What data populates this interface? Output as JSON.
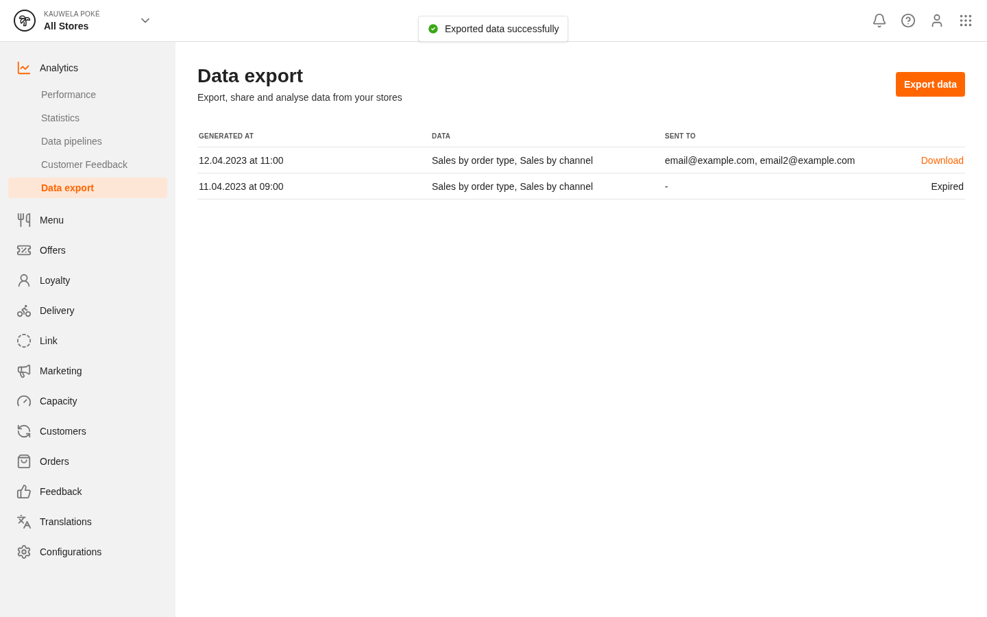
{
  "header": {
    "brand": "KAUWELA POKÉ",
    "store": "All Stores"
  },
  "toast": {
    "message": "Exported data successfully"
  },
  "sidebar": {
    "items": [
      {
        "label": "Analytics",
        "selected": true,
        "expanded": true,
        "children": [
          {
            "label": "Performance",
            "selected": false
          },
          {
            "label": "Statistics",
            "selected": false
          },
          {
            "label": "Data pipelines",
            "selected": false
          },
          {
            "label": "Customer Feedback",
            "selected": false
          },
          {
            "label": "Data export",
            "selected": true
          }
        ]
      },
      {
        "label": "Menu",
        "selected": false
      },
      {
        "label": "Offers",
        "selected": false
      },
      {
        "label": "Loyalty",
        "selected": false
      },
      {
        "label": "Delivery",
        "selected": false
      },
      {
        "label": "Link",
        "selected": false
      },
      {
        "label": "Marketing",
        "selected": false
      },
      {
        "label": "Capacity",
        "selected": false
      },
      {
        "label": "Customers",
        "selected": false
      },
      {
        "label": "Orders",
        "selected": false
      },
      {
        "label": "Feedback",
        "selected": false
      },
      {
        "label": "Translations",
        "selected": false
      },
      {
        "label": "Configurations",
        "selected": false
      }
    ]
  },
  "page": {
    "title": "Data export",
    "subtitle": "Export, share and analyse data from your stores",
    "action": "Export data"
  },
  "table": {
    "columns": [
      "GENERATED AT",
      "DATA",
      "SENT TO"
    ],
    "rows": [
      {
        "generated_at": "12.04.2023 at 11:00",
        "data": "Sales by order type, Sales by channel",
        "sent_to": "email@example.com, email2@example.com",
        "status": {
          "kind": "link",
          "text": "Download"
        }
      },
      {
        "generated_at": "11.04.2023 at 09:00",
        "data": "Sales by order type, Sales by channel",
        "sent_to": "-",
        "status": {
          "kind": "text",
          "text": "Expired"
        }
      }
    ]
  }
}
